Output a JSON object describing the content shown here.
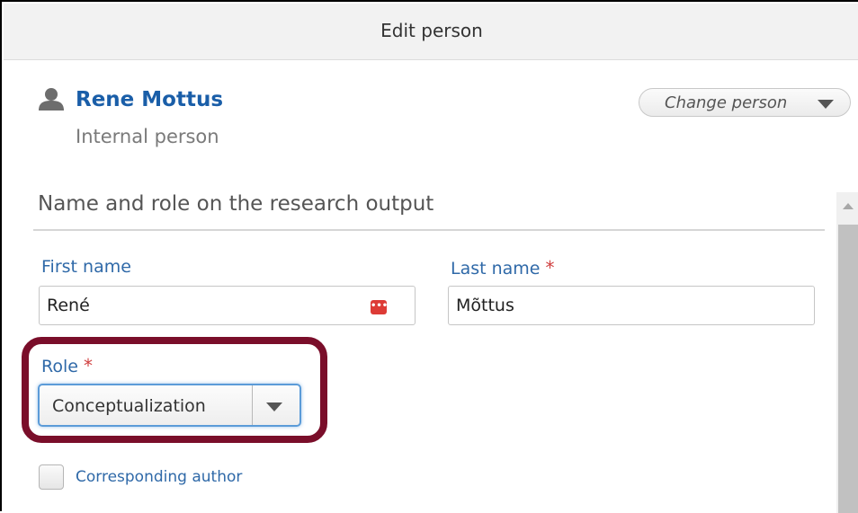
{
  "dialog": {
    "title": "Edit person"
  },
  "person": {
    "name": "Rene Mottus",
    "type": "Internal person",
    "change_label": "Change person"
  },
  "section": {
    "title": "Name and role on the research output"
  },
  "fields": {
    "first_name": {
      "label": "First name",
      "value": "René",
      "badge": "•••|"
    },
    "last_name": {
      "label": "Last name",
      "required_mark": "*",
      "value": "Mõttus"
    },
    "role": {
      "label": "Role",
      "required_mark": "*",
      "value": "Conceptualization"
    },
    "corresponding_author": {
      "label": "Corresponding author",
      "checked": false
    }
  },
  "colors": {
    "link": "#1a5ea8",
    "label": "#2f69a8",
    "required": "#d04040",
    "highlight": "#7a0e2a",
    "focus": "#5b9bd8"
  }
}
